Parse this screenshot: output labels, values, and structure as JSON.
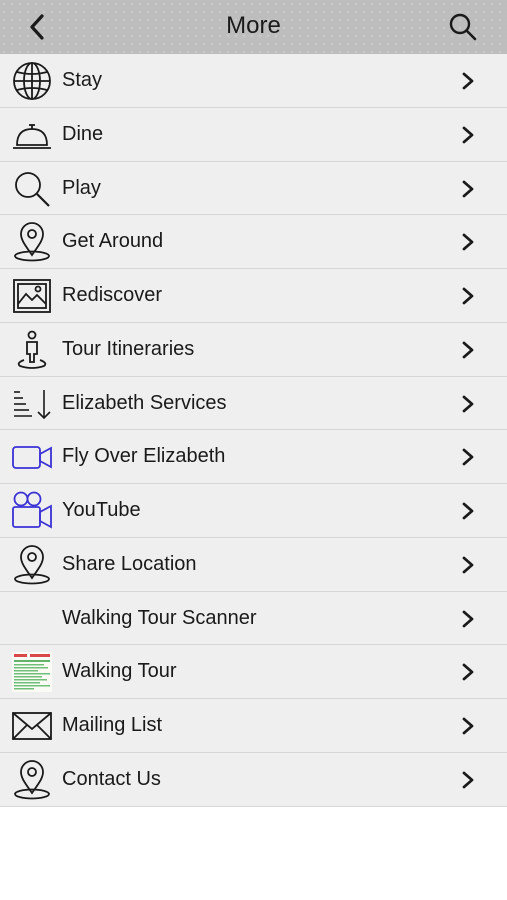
{
  "navbar": {
    "title": "More",
    "back_icon": "chevron-left-icon",
    "search_icon": "search-icon"
  },
  "colors": {
    "navbar_bg": "#bdbdbd",
    "row_bg": "#efefef",
    "text": "#1a1a1a",
    "video_icon": "#3b32d6",
    "divider": "#d6d6d6"
  },
  "menu": {
    "items": [
      {
        "label": "Stay",
        "icon": "globe-icon"
      },
      {
        "label": "Dine",
        "icon": "service-bell-icon"
      },
      {
        "label": "Play",
        "icon": "search-icon"
      },
      {
        "label": "Get Around",
        "icon": "map-pin-icon"
      },
      {
        "label": "Rediscover",
        "icon": "picture-icon"
      },
      {
        "label": "Tour Itineraries",
        "icon": "person-on-pin-icon"
      },
      {
        "label": "Elizabeth Services",
        "icon": "sort-descending-icon"
      },
      {
        "label": "Fly Over Elizabeth",
        "icon": "video-camera-icon"
      },
      {
        "label": "YouTube",
        "icon": "movie-camera-icon"
      },
      {
        "label": "Share Location",
        "icon": "map-pin-icon"
      },
      {
        "label": "Walking Tour Scanner",
        "icon": ""
      },
      {
        "label": "Walking Tour",
        "icon": "walking-tour-thumbnail"
      },
      {
        "label": "Mailing List",
        "icon": "envelope-icon"
      },
      {
        "label": "Contact Us",
        "icon": "map-pin-icon"
      }
    ]
  }
}
